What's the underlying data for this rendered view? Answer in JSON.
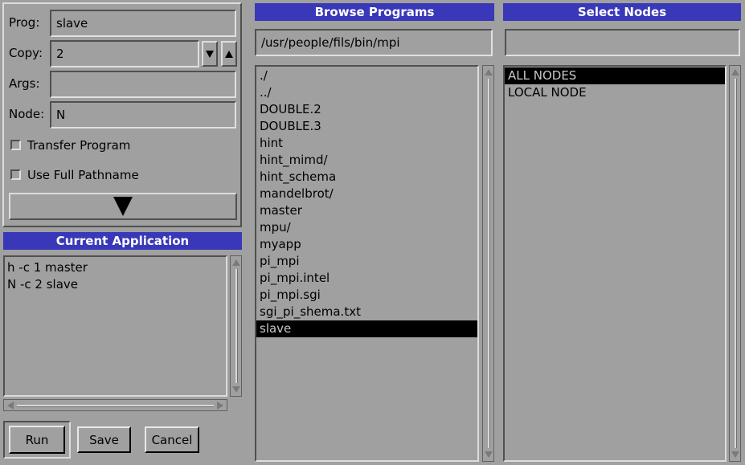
{
  "form": {
    "prog_label": "Prog:",
    "prog_value": "slave",
    "copy_label": "Copy:",
    "copy_value": "2",
    "args_label": "Args:",
    "args_value": "",
    "node_label": "Node:",
    "node_value": "N",
    "transfer_label": "Transfer Program",
    "fullpath_label": "Use Full Pathname"
  },
  "current_app": {
    "title": "Current Application",
    "items": [
      "h -c 1 master",
      "N -c 2 slave"
    ]
  },
  "buttons": {
    "run": "Run",
    "save": "Save",
    "cancel": "Cancel"
  },
  "browse": {
    "title": "Browse Programs",
    "path": "/usr/people/fils/bin/mpi",
    "items": [
      {
        "label": "./",
        "selected": false
      },
      {
        "label": "../",
        "selected": false
      },
      {
        "label": "DOUBLE.2",
        "selected": false
      },
      {
        "label": "DOUBLE.3",
        "selected": false
      },
      {
        "label": "hint",
        "selected": false
      },
      {
        "label": "hint_mimd/",
        "selected": false
      },
      {
        "label": "hint_schema",
        "selected": false
      },
      {
        "label": "mandelbrot/",
        "selected": false
      },
      {
        "label": "master",
        "selected": false
      },
      {
        "label": "mpu/",
        "selected": false
      },
      {
        "label": "myapp",
        "selected": false
      },
      {
        "label": "pi_mpi",
        "selected": false
      },
      {
        "label": "pi_mpi.intel",
        "selected": false
      },
      {
        "label": "pi_mpi.sgi",
        "selected": false
      },
      {
        "label": "sgi_pi_shema.txt",
        "selected": false
      },
      {
        "label": "slave",
        "selected": true
      }
    ]
  },
  "nodes": {
    "title": "Select Nodes",
    "filter": "",
    "items": [
      {
        "label": "ALL NODES",
        "selected": true
      },
      {
        "label": "LOCAL NODE",
        "selected": false
      }
    ]
  },
  "colors": {
    "background": "#a0a0a0",
    "title_bar": "#3838b8",
    "selection": "#000000"
  }
}
